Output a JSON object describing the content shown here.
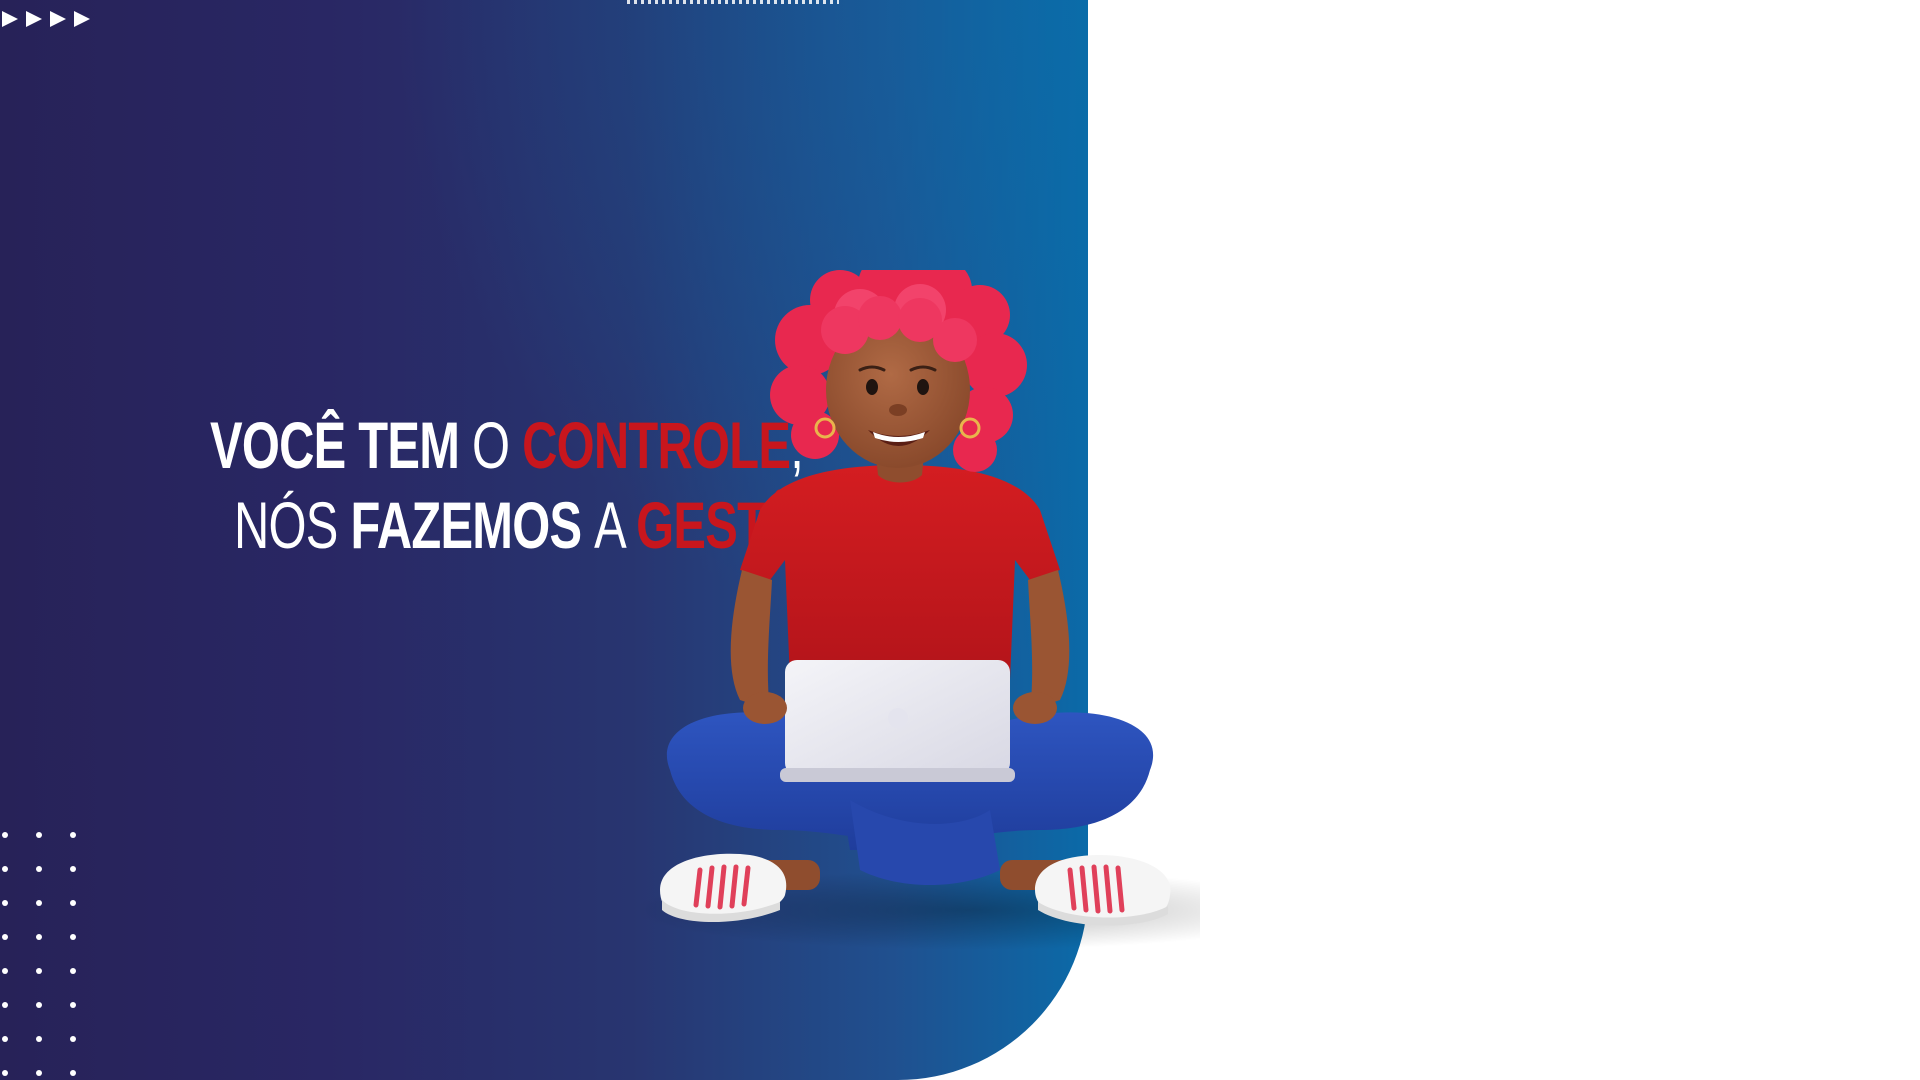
{
  "headline": {
    "line1": [
      {
        "text": "VOCÊ TEM ",
        "style": "bold-white"
      },
      {
        "text": "O ",
        "style": "thin-white"
      },
      {
        "text": "CONTROLE",
        "style": "bold-red"
      },
      {
        "text": ",",
        "style": "thin-white"
      }
    ],
    "line2": [
      {
        "text": "NÓS ",
        "style": "thin-white"
      },
      {
        "text": "FAZEMOS ",
        "style": "bold-white"
      },
      {
        "text": "A ",
        "style": "thin-white"
      },
      {
        "text": "GESTÃO",
        "style": "bold-red"
      },
      {
        "text": "!",
        "style": "thin-white"
      }
    ]
  },
  "colors": {
    "panel_dark": "#272258",
    "panel_light": "#0b6aa8",
    "accent_red": "#c8161d",
    "text_white": "#ffffff",
    "background": "#ffffff"
  },
  "decorations": {
    "arrow_icons": [
      "play-arrow-icon",
      "play-arrow-icon",
      "play-arrow-icon",
      "play-arrow-icon"
    ],
    "dot_grid": {
      "columns": 3,
      "rows": 8
    }
  },
  "illustration": {
    "subject": "person-with-laptop-illustration"
  }
}
